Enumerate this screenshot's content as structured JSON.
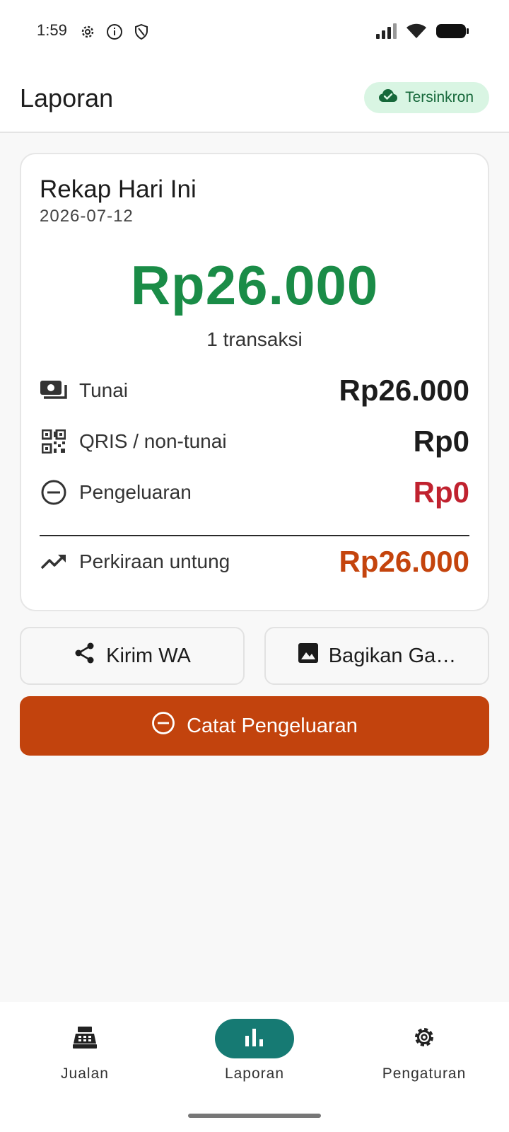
{
  "status_bar": {
    "time": "1:59",
    "icons": [
      "settings-gear-icon",
      "info-icon",
      "shield-icon",
      "signal-icon",
      "wifi-icon",
      "battery-icon"
    ]
  },
  "app_bar": {
    "title": "Laporan",
    "sync_status": "Tersinkron",
    "sync_icon": "cloud-check-icon"
  },
  "summary": {
    "title": "Rekap Hari Ini",
    "date": "2026-07-12",
    "total": "Rp26.000",
    "transaction_count": "1 transaksi",
    "rows": [
      {
        "icon": "cash-icon",
        "label": "Tunai",
        "value": "Rp26.000"
      },
      {
        "icon": "qr-code-icon",
        "label": "QRIS / non-tunai",
        "value": "Rp0"
      },
      {
        "icon": "minus-circle-icon",
        "label": "Pengeluaran",
        "value": "Rp0"
      }
    ],
    "profit": {
      "icon": "trending-up-icon",
      "label": "Perkiraan untung",
      "value": "Rp26.000"
    }
  },
  "actions": {
    "send_wa": "Kirim WA",
    "share_image": "Bagikan Ga…",
    "record_expense": "Catat Pengeluaran"
  },
  "bottom_nav": {
    "items": [
      {
        "label": "Jualan",
        "icon": "cash-register-icon",
        "active": false
      },
      {
        "label": "Laporan",
        "icon": "bar-chart-icon",
        "active": true
      },
      {
        "label": "Pengaturan",
        "icon": "settings-icon",
        "active": false
      }
    ]
  },
  "colors": {
    "accent_green": "#1a8c47",
    "expense_red": "#c0222f",
    "profit_orange": "#c4440d",
    "primary_button": "#c2430d",
    "nav_active": "#167a73",
    "sync_chip_bg": "#d9f5e3"
  }
}
